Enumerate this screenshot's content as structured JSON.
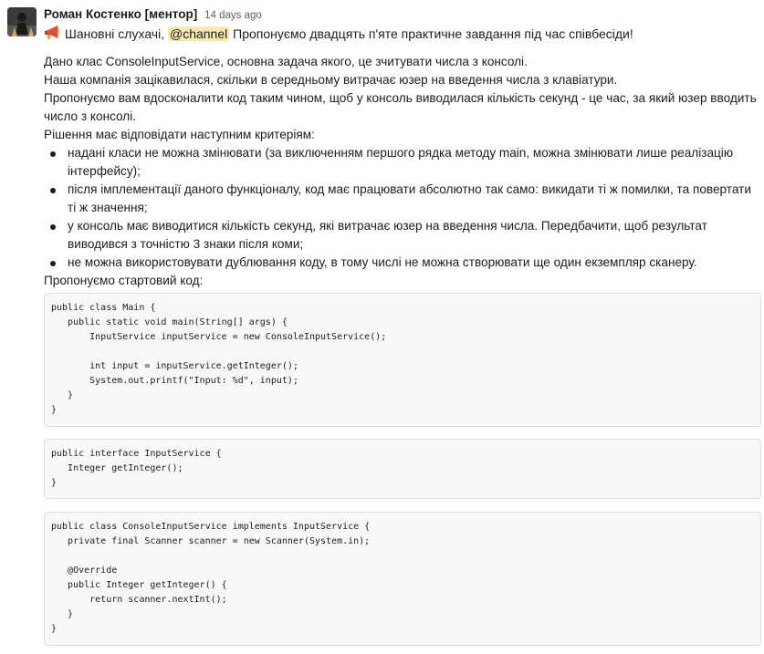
{
  "message": {
    "author": "Роман Костенко [ментор]",
    "timestamp": "14 days ago",
    "greeting_prefix": "Шановні слухачі,",
    "mention": "@channel",
    "greeting_suffix": "Пропонуємо двадцять п'яте практичне завдання під час співбесіди!",
    "intro_lines": [
      "Дано клас ConsoleInputService, основна задача якого, це зчитувати числа з консолі.",
      "Наша компанія зацікавилася, скільки в середньому витрачає юзер на введення числа з клавіатури.",
      "Пропонуємо вам вдосконалити код таким чином, щоб у консоль виводилася кількість секунд - це час, за який юзер вводить число з консолі.",
      "Рішення має відповідати наступним критеріям:"
    ],
    "criteria": [
      "надані класи не можна змінювати (за виключенням першого рядка методу main, можна змінювати лише реалізацію інтерфейсу);",
      "після імплементації даного функціоналу, код має працювати абсолютно так само: викидати ті ж помилки, та повертати ті ж значення;",
      "у консоль має виводитися кількість секунд, які витрачає юзер на введення числа.  Передбачити, щоб результат виводився з точністю 3 знаки після коми;",
      "не можна використовувати дублювання коду, в тому числі не можна створювати ще один екземпляр сканеру."
    ],
    "starter_label": "Пропонуємо стартовий код:",
    "code_blocks": [
      "public class Main {\n   public static void main(String[] args) {\n       InputService inputService = new ConsoleInputService();\n\n       int input = inputService.getInteger();\n       System.out.printf(\"Input: %d\", input);\n   }\n}",
      "public interface InputService {\n   Integer getInteger();\n}",
      "public class ConsoleInputService implements InputService {\n   private final Scanner scanner = new Scanner(System.in);\n\n   @Override\n   public Integer getInteger() {\n       return scanner.nextInt();\n   }\n}"
    ]
  },
  "colors": {
    "mention_bg": "#f8e8b0",
    "code_bg": "#f8f8f8",
    "code_border": "#dddddd",
    "text": "#1d1c1d",
    "timestamp": "#616061"
  },
  "icons": {
    "avatar": "user-avatar",
    "emoji": "megaphone-icon"
  }
}
